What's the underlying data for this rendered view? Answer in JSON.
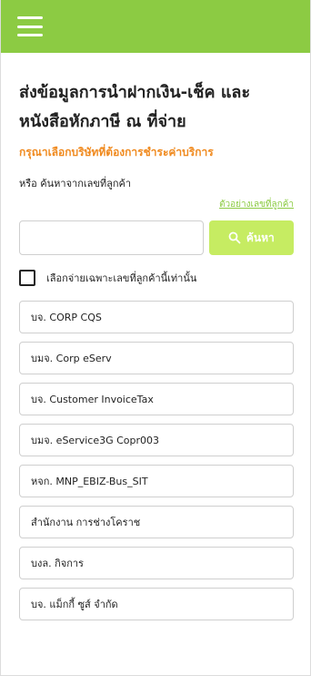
{
  "header": {
    "menu_icon": "hamburger-icon",
    "accent_color": "#8ccb43"
  },
  "page": {
    "title": "ส่งข้อมูลการนำฝากเงิน-เช็ค และหนังสือหักภาษี ณ ที่จ่าย",
    "subtitle": "กรุณาเลือกบริษัทที่ต้องการชำระค่าบริการ",
    "search_label": "หรือ ค้นหาจากเลขที่ลูกค้า",
    "example_link": "ตัวอย่างเลขที่ลูกค้า",
    "search": {
      "value": "",
      "placeholder": "",
      "button_label": "ค้นหา",
      "button_icon": "search-icon",
      "button_color": "#c6ec62"
    },
    "checkbox_label": "เลือกจ่ายเฉพาะเลขที่ลูกค้านี้เท่านั้น",
    "subtitle_color": "#f08a1f"
  },
  "companies": [
    {
      "label": "บจ. CORP CQS"
    },
    {
      "label": "บมจ. Corp eServ"
    },
    {
      "label": "บจ. Customer InvoiceTax"
    },
    {
      "label": "บมจ. eService3G Copr003"
    },
    {
      "label": "หจก. MNP_EBIZ-Bus_SIT"
    },
    {
      "label": "สำนักงาน การช่างโคราช"
    },
    {
      "label": "บงล. กิจการ"
    },
    {
      "label": "บจ. แม็กกี้ ซูส์ จำกัด"
    }
  ]
}
